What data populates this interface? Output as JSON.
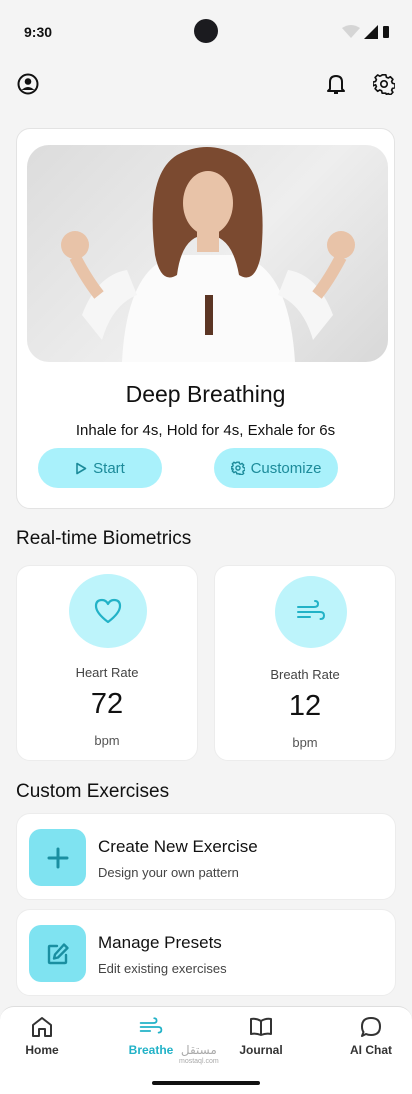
{
  "status_bar": {
    "time": "9:30"
  },
  "hero": {
    "title": "Deep Breathing",
    "subtitle": "Inhale for 4s, Hold for 4s, Exhale for 6s",
    "start_label": "Start",
    "customize_label": "Customize"
  },
  "biometrics": {
    "section_title": "Real-time Biometrics",
    "cards": [
      {
        "label": "Heart Rate",
        "value": "72",
        "unit": "bpm",
        "icon": "heart-icon"
      },
      {
        "label": "Breath Rate",
        "value": "12",
        "unit": "bpm",
        "icon": "wind-icon"
      }
    ]
  },
  "custom": {
    "section_title": "Custom Exercises",
    "items": [
      {
        "title": "Create New Exercise",
        "subtitle": "Design your own pattern",
        "icon": "plus-icon"
      },
      {
        "title": "Manage Presets",
        "subtitle": "Edit existing exercises",
        "icon": "edit-icon"
      }
    ]
  },
  "nav": {
    "items": [
      {
        "label": "Home",
        "icon": "home-icon",
        "active": false
      },
      {
        "label": "Breathe",
        "icon": "wind-icon",
        "active": true
      },
      {
        "label": "Journal",
        "icon": "book-icon",
        "active": false
      },
      {
        "label": "AI Chat",
        "icon": "chat-icon",
        "active": false
      }
    ],
    "watermark": "مستقل",
    "watermark_sub": "mostaql.com"
  },
  "colors": {
    "accent": "#22b2c7",
    "pill_bg": "#a9f1fb",
    "icon_tile": "#7fe3f1",
    "background": "#f4f4f4"
  }
}
